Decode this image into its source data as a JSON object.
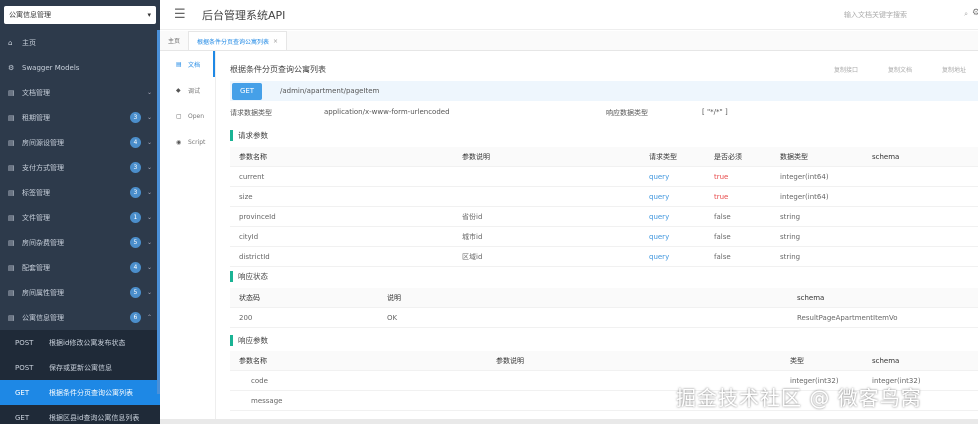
{
  "sidebar": {
    "group_select": "公寓信息管理",
    "items": [
      {
        "icon": "⌂",
        "label": "主页",
        "badge": "",
        "chevron": ""
      },
      {
        "icon": "⚙",
        "label": "Swagger Models",
        "badge": "",
        "chevron": ""
      },
      {
        "icon": "▤",
        "label": "文档管理",
        "badge": "",
        "chevron": "⌄"
      },
      {
        "icon": "▤",
        "label": "租期管理",
        "badge": "3",
        "chevron": "⌄"
      },
      {
        "icon": "▤",
        "label": "房间源设管理",
        "badge": "4",
        "chevron": "⌄"
      },
      {
        "icon": "▤",
        "label": "支付方式管理",
        "badge": "3",
        "chevron": "⌄"
      },
      {
        "icon": "▤",
        "label": "标签管理",
        "badge": "3",
        "chevron": "⌄"
      },
      {
        "icon": "▤",
        "label": "文件管理",
        "badge": "1",
        "chevron": "⌄"
      },
      {
        "icon": "▤",
        "label": "房间杂费管理",
        "badge": "5",
        "chevron": "⌄"
      },
      {
        "icon": "▤",
        "label": "配套管理",
        "badge": "4",
        "chevron": "⌄"
      },
      {
        "icon": "▤",
        "label": "房间属性管理",
        "badge": "5",
        "chevron": "⌄"
      },
      {
        "icon": "▤",
        "label": "公寓信息管理",
        "badge": "6",
        "chevron": "⌃"
      }
    ],
    "sub_items": [
      {
        "method": "POST",
        "label": "根据id修改公寓发布状态",
        "active": false
      },
      {
        "method": "POST",
        "label": "保存或更新公寓信息",
        "active": false
      },
      {
        "method": "GET",
        "label": "根据条件分页查询公寓列表",
        "active": true
      },
      {
        "method": "GET",
        "label": "根据区县id查询公寓信息列表",
        "active": false
      }
    ]
  },
  "header": {
    "menu_icon": "☰",
    "title": "后台管理系统API",
    "search_placeholder": "输入文档关键字搜索",
    "search_icon": "⌕",
    "settings_icon": "⚙"
  },
  "tabs": [
    {
      "label": "主页",
      "active": false
    },
    {
      "label": "根据条件分页查询公寓列表",
      "active": true,
      "close": "×"
    }
  ],
  "subnav": [
    {
      "icon": "▤",
      "label": "文档",
      "active": true
    },
    {
      "icon": "◆",
      "label": "调试",
      "active": false
    },
    {
      "icon": "▢",
      "label": "Open",
      "active": false
    },
    {
      "icon": "◉",
      "label": "Script",
      "active": false
    }
  ],
  "doc": {
    "title": "根据条件分页查询公寓列表",
    "actions": [
      "复制接口",
      "复制文档",
      "复制地址"
    ],
    "method": "GET",
    "url": "/admin/apartment/pageItem",
    "request_type_label": "请求数据类型",
    "request_type_value": "application/x-www-form-urlencoded",
    "response_type_label": "响应数据类型",
    "response_type_value": "[ \"*/*\" ]"
  },
  "request_params": {
    "section": "请求参数",
    "headers": [
      "参数名称",
      "参数说明",
      "请求类型",
      "是否必须",
      "数据类型",
      "schema"
    ],
    "rows": [
      [
        "current",
        "",
        "query",
        "true",
        "integer(int64)",
        ""
      ],
      [
        "size",
        "",
        "query",
        "true",
        "integer(int64)",
        ""
      ],
      [
        "provinceId",
        "省份id",
        "query",
        "false",
        "string",
        ""
      ],
      [
        "cityId",
        "城市id",
        "query",
        "false",
        "string",
        ""
      ],
      [
        "districtId",
        "区域id",
        "query",
        "false",
        "string",
        ""
      ]
    ]
  },
  "response_status": {
    "section": "响应状态",
    "headers": [
      "状态码",
      "说明",
      "schema"
    ],
    "rows": [
      [
        "200",
        "OK",
        "ResultPageApartmentItemVo"
      ]
    ]
  },
  "response_params": {
    "section": "响应参数",
    "headers": [
      "参数名称",
      "参数说明",
      "类型",
      "schema"
    ],
    "rows": [
      [
        "code",
        "",
        "integer(int32)",
        "integer(int32)"
      ],
      [
        "message",
        "",
        "",
        ""
      ]
    ]
  },
  "watermark": "掘金技术社区 @ 微客鸟窝",
  "colors": {
    "sidebar_bg": "#2d3a4b",
    "accent": "#1e88e5",
    "get_button": "#45a0e8",
    "section_bar": "#1ab394",
    "true_red": "#e84b4b",
    "query_blue": "#3e95dd"
  }
}
